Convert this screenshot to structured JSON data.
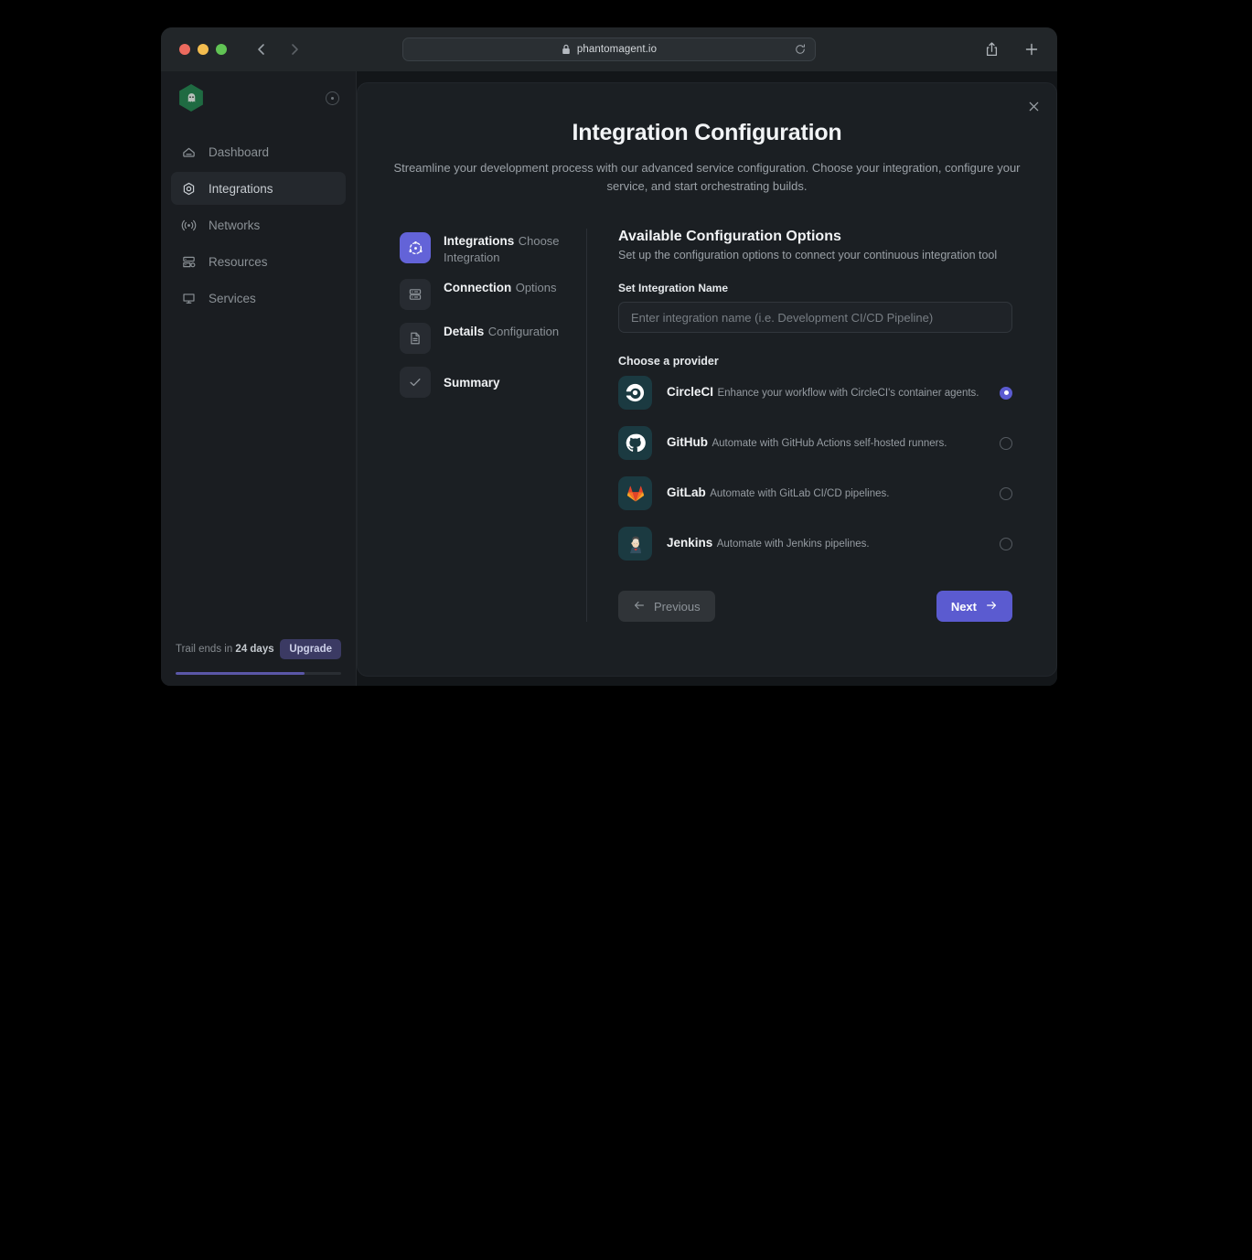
{
  "browser": {
    "url": "phantomagent.io",
    "lock_icon": "lock-icon",
    "reload_icon": "reload-icon",
    "back_icon": "chevron-left-icon",
    "forward_icon": "chevron-right-icon",
    "share_icon": "share-icon",
    "newtab_icon": "plus-icon"
  },
  "sidebar": {
    "logo_icon": "ghost-logo-icon",
    "collapse_icon": "collapse-sidebar-icon",
    "items": [
      {
        "label": "Dashboard",
        "icon": "home-icon",
        "active": false
      },
      {
        "label": "Integrations",
        "icon": "hexagon-icon",
        "active": true
      },
      {
        "label": "Networks",
        "icon": "broadcast-icon",
        "active": false
      },
      {
        "label": "Resources",
        "icon": "server-icon",
        "active": false
      },
      {
        "label": "Services",
        "icon": "monitor-icon",
        "active": false
      }
    ],
    "trial_prefix": "Trail ends in",
    "trial_days": "24 days",
    "upgrade_label": "Upgrade",
    "progress_percent": 78
  },
  "modal": {
    "close_icon": "close-icon",
    "title": "Integration Configuration",
    "subtitle": "Streamline your development process with our advanced service configuration. Choose your integration, configure your service, and start orchestrating builds.",
    "steps": [
      {
        "title": "Integrations",
        "desc": "Choose Integration",
        "icon": "integrations-node-icon",
        "active": true
      },
      {
        "title": "Connection",
        "desc": "Options",
        "icon": "server-rack-icon",
        "active": false
      },
      {
        "title": "Details",
        "desc": "Configuration",
        "icon": "document-icon",
        "active": false
      },
      {
        "title": "Summary",
        "desc": "",
        "icon": "check-icon",
        "active": false
      }
    ],
    "panel": {
      "title": "Available Configuration Options",
      "subtitle": "Set up the configuration options to connect your continuous integration tool",
      "name_label": "Set Integration Name",
      "name_value": "",
      "name_placeholder": "Enter integration name (i.e. Development CI/CD Pipeline)",
      "choose_label": "Choose a provider",
      "providers": [
        {
          "name": "CircleCI",
          "desc": "Enhance your workflow with CircleCI's container agents.",
          "icon": "circleci-icon",
          "selected": true
        },
        {
          "name": "GitHub",
          "desc": "Automate with GitHub Actions self-hosted runners.",
          "icon": "github-icon",
          "selected": false
        },
        {
          "name": "GitLab",
          "desc": "Automate with GitLab CI/CD pipelines.",
          "icon": "gitlab-icon",
          "selected": false
        },
        {
          "name": "Jenkins",
          "desc": "Automate with Jenkins pipelines.",
          "icon": "jenkins-icon",
          "selected": false
        }
      ],
      "previous_label": "Previous",
      "next_label": "Next",
      "prev_icon": "arrow-left-icon",
      "next_icon": "arrow-right-icon"
    }
  },
  "colors": {
    "accent": "#5b5bd0",
    "modal_bg": "#1b1f23",
    "sidebar_bg": "#1a1d21",
    "provider_icon_bg": "#1b3a41",
    "logo_green": "#1f6b42"
  }
}
